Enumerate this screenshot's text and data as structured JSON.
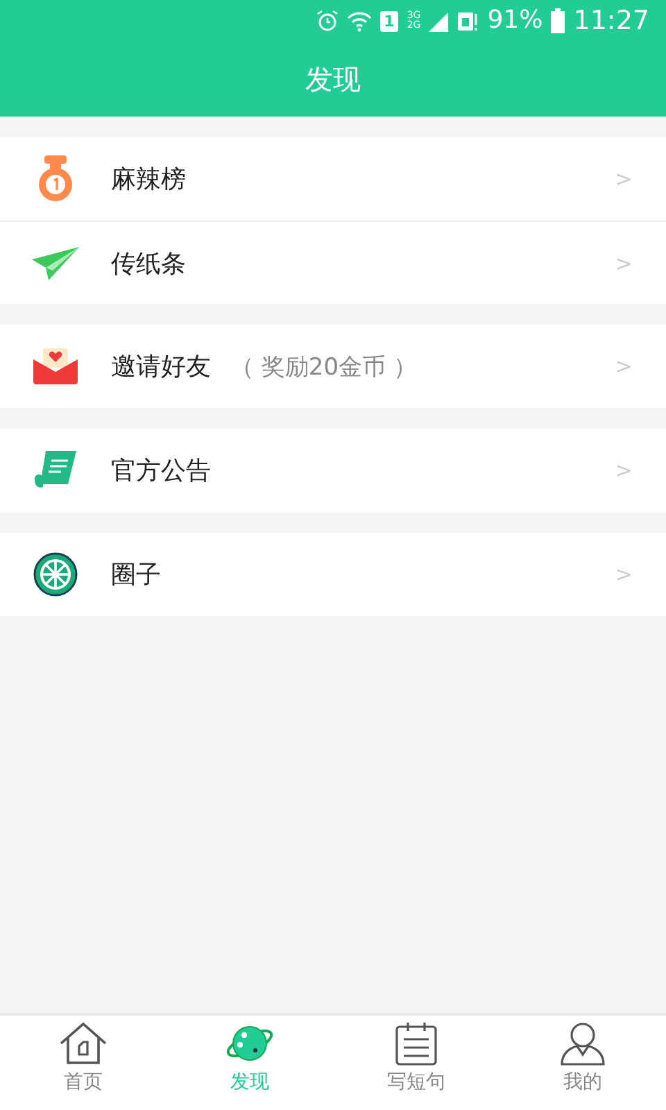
{
  "status_bar": {
    "sim": "1",
    "networks": [
      "3G",
      "2G"
    ],
    "battery": "91%",
    "time": "11:27"
  },
  "header": {
    "title": "发现"
  },
  "groups": [
    {
      "items": [
        {
          "kind": "medal",
          "label": "麻辣榜",
          "arrow": ">"
        },
        {
          "kind": "plane",
          "label": "传纸条",
          "arrow": ">"
        }
      ]
    },
    {
      "items": [
        {
          "kind": "envelope",
          "label": "邀请好友",
          "note": "（ 奖励20金币 ）",
          "arrow": ">"
        }
      ]
    },
    {
      "items": [
        {
          "kind": "scroll",
          "label": "官方公告",
          "arrow": ">"
        }
      ]
    },
    {
      "items": [
        {
          "kind": "wheel",
          "label": "圈子",
          "arrow": ">"
        }
      ]
    }
  ],
  "tabs": [
    {
      "kind": "home",
      "label": "首页",
      "selected": false
    },
    {
      "kind": "planet",
      "label": "发现",
      "selected": true
    },
    {
      "kind": "notepad",
      "label": "写短句",
      "selected": false
    },
    {
      "kind": "person",
      "label": "我的",
      "selected": false
    }
  ]
}
